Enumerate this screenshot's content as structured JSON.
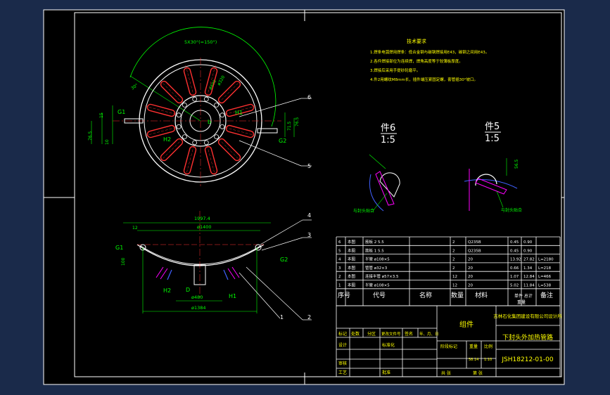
{
  "colors": {
    "frame_bg": "#1a2a4a",
    "paper": "#000000",
    "white": "#ffffff",
    "red": "#ff3030",
    "green": "#00ff00",
    "yellow": "#ffff00",
    "cyan": "#00ffff",
    "magenta": "#ff00ff",
    "blue": "#4060ff"
  },
  "notes": {
    "title": "技术要求",
    "items": [
      "1.焊条电弧焊用焊条：低合金钢与碳钢焊接用E43，碳钢之间用E43。",
      "2.各件焊接部位为连续焊，焊角高度等于较薄板厚度。",
      "3.焊接后采用手提砂轮磨平。",
      "4.件2用螺纹M8mm长，插件端压紧固定螺，套管插30°坡口。"
    ]
  },
  "top_view": {
    "angle_dim": "5X30°(=150°)",
    "dims": [
      "30°",
      "ø320",
      "ø490",
      "15",
      "76.5",
      "71.5",
      "10",
      "76.5"
    ],
    "labels": {
      "g1": "G1",
      "h1": "H1",
      "b": "b",
      "h2": "H2",
      "g2": "G2"
    }
  },
  "front_view": {
    "dims": [
      "1997.4",
      "ø1400",
      "12",
      "ø480",
      "ø1384",
      "100"
    ],
    "labels": {
      "g1": "G1",
      "g2": "G2",
      "d": "D",
      "h1": "H1",
      "h2": "H2"
    }
  },
  "details": [
    {
      "title": "件6",
      "scale": "1:5",
      "note": "与封头贴合"
    },
    {
      "title": "件5",
      "scale": "1:5",
      "note": "与封头贴合",
      "dim": "56.5"
    }
  ],
  "callouts": [
    "6",
    "5",
    "4",
    "3",
    "1",
    "2"
  ],
  "bom": {
    "rows": [
      {
        "no": "6",
        "code": "本图",
        "name": "筋板 2  5.5",
        "qty": "2",
        "material": "Q235B",
        "w1": "0.45",
        "w2": "0.90",
        "note": ""
      },
      {
        "no": "5",
        "code": "本图",
        "name": "筋板 1  5.5",
        "qty": "2",
        "material": "Q235B",
        "w1": "0.45",
        "w2": "0.90",
        "note": ""
      },
      {
        "no": "4",
        "code": "本图",
        "name": "半管 ø108×5",
        "qty": "2",
        "material": "20",
        "w1": "13.92",
        "w2": "27.82",
        "note": "L=2180"
      },
      {
        "no": "3",
        "code": "本图",
        "name": "管管 ø32×3",
        "qty": "2",
        "material": "20",
        "w1": "0.66",
        "w2": "1.34",
        "note": "L=218"
      },
      {
        "no": "2",
        "code": "本图",
        "name": "连接半管 ø57×3.5",
        "qty": "12",
        "material": "20",
        "w1": "1.07",
        "w2": "12.84",
        "note": "L=466"
      },
      {
        "no": "1",
        "code": "本图",
        "name": "半管 ø108×5",
        "qty": "12",
        "material": "20",
        "w1": "5.02",
        "w2": "11.84",
        "note": "L=538"
      }
    ],
    "header": {
      "no": "序号",
      "code": "代号",
      "name": "名称",
      "qty": "数量",
      "material": "材料",
      "weight": "单件 总计",
      "weight2": "重量",
      "note": "备注"
    }
  },
  "title_block": {
    "company": "吉林石化集团建设有限公司设计所",
    "part_group": "组件",
    "drawing_title": "下封头外加热管路",
    "drawing_no": "JSH18212-01-00",
    "mark_label": "标记",
    "count_label": "处数",
    "zone_label": "分区",
    "change_label": "更改文件号",
    "sign_label": "签名",
    "date_label": "年、月、日",
    "design_label": "设计",
    "std_label": "标准化",
    "review_label": "审核",
    "process_label": "工艺",
    "approve_label": "批准",
    "stage_label": "阶段标记",
    "weight_label": "重量",
    "scale_label": "比例",
    "weight_value": "58.14",
    "scale_value": "1:10",
    "sheet_total": "共  张",
    "sheet_no": "第  张"
  }
}
